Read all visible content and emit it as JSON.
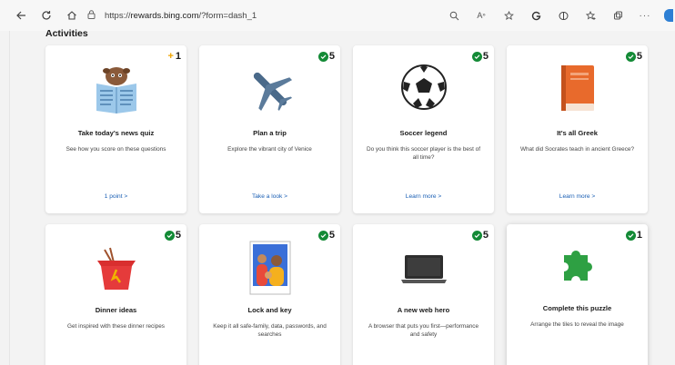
{
  "browser": {
    "url_prefix": "https://",
    "url_host": "rewards.bing.com",
    "url_path": "/?form=dash_1"
  },
  "section": {
    "title": "Activities"
  },
  "cards": [
    {
      "title": "Take today's news quiz",
      "desc": "See how you score on these questions",
      "link": "1 point >",
      "points": "1",
      "badge": "plus"
    },
    {
      "title": "Plan a trip",
      "desc": "Explore the vibrant city of Venice",
      "link": "Take a look >",
      "points": "5",
      "badge": "check"
    },
    {
      "title": "Soccer legend",
      "desc": "Do you think this soccer player is the best of all time?",
      "link": "Learn more >",
      "points": "5",
      "badge": "check"
    },
    {
      "title": "It's all Greek",
      "desc": "What did Socrates teach in ancient Greece?",
      "link": "Learn more >",
      "points": "5",
      "badge": "check"
    },
    {
      "title": "Dinner ideas",
      "desc": "Get inspired with these dinner recipes",
      "link": "",
      "points": "5",
      "badge": "check"
    },
    {
      "title": "Lock and key",
      "desc": "Keep it all safe-family, data, passwords, and searches",
      "link": "",
      "points": "5",
      "badge": "check"
    },
    {
      "title": "A new web hero",
      "desc": "A browser that puts you first—performance and safety",
      "link": "",
      "points": "5",
      "badge": "check"
    },
    {
      "title": "Complete this puzzle",
      "desc": "Arrange the tiles to reveal the image",
      "link": "",
      "points": "1",
      "badge": "check"
    }
  ],
  "colors": {
    "completed": "#138a36",
    "pending": "#f0a500",
    "link": "#1a5fb4"
  }
}
